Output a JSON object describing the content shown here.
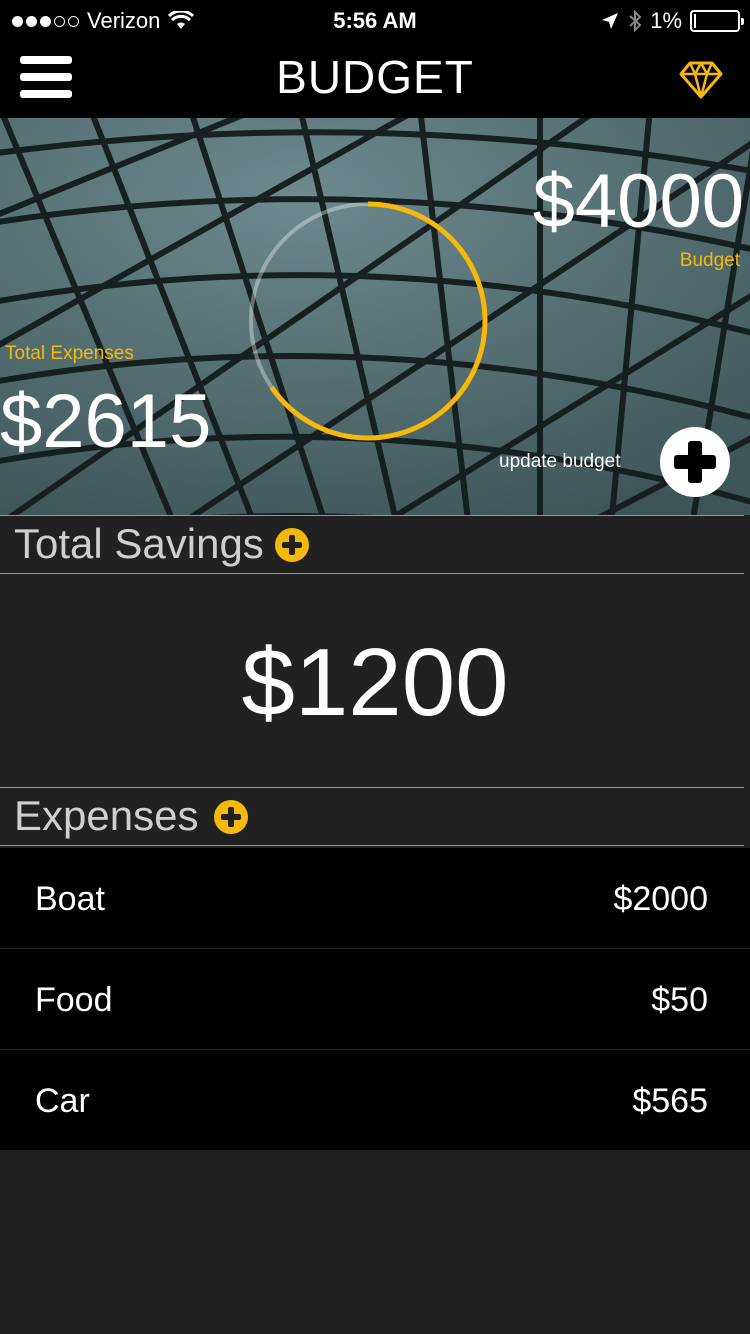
{
  "status_bar": {
    "carrier": "Verizon",
    "time": "5:56 AM",
    "battery": "1%"
  },
  "nav": {
    "title": "BUDGET",
    "menu_icon": "hamburger-menu-icon",
    "premium_icon": "diamond-icon"
  },
  "summary": {
    "budget_amount": "$4000",
    "budget_label": "Budget",
    "expenses_label": "Total Expenses",
    "expenses_amount": "$2615",
    "spent_fraction": 0.654,
    "update_label": "update budget"
  },
  "savings": {
    "title": "Total Savings",
    "amount": "$1200"
  },
  "expenses": {
    "title": "Expenses",
    "items": [
      {
        "name": "Boat",
        "amount": "$2000"
      },
      {
        "name": "Food",
        "amount": "$50"
      },
      {
        "name": "Car",
        "amount": "$565"
      }
    ]
  },
  "colors": {
    "accent": "#f5b80d",
    "background": "#212121",
    "bar": "#000000"
  }
}
